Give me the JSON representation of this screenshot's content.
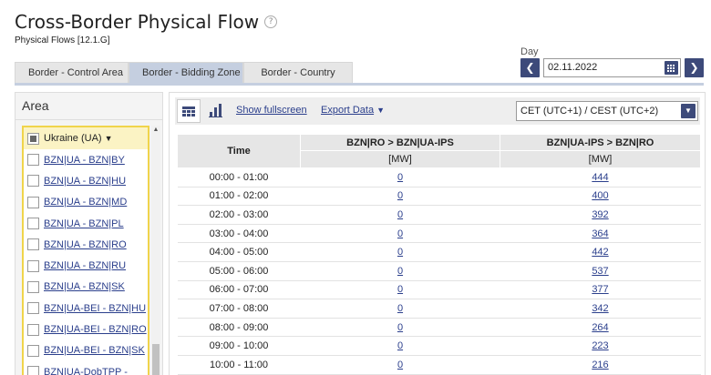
{
  "header": {
    "title": "Cross-Border Physical Flow",
    "help_icon": "?",
    "subtitle": "Physical Flows [12.1.G]"
  },
  "tabs": [
    {
      "label": "Border - Control Area",
      "active": false
    },
    {
      "label": "Border - Bidding Zone",
      "active": true
    },
    {
      "label": "Border - Country",
      "active": false
    }
  ],
  "day": {
    "label": "Day",
    "value": "02.11.2022",
    "prev_icon": "❮",
    "next_icon": "❯"
  },
  "area": {
    "title": "Area",
    "group_label": "Ukraine (UA)",
    "caret": "▼",
    "scroll_up": "▲",
    "items": [
      "BZN|UA - BZN|BY",
      "BZN|UA - BZN|HU",
      "BZN|UA - BZN|MD",
      "BZN|UA - BZN|PL",
      "BZN|UA - BZN|RO",
      "BZN|UA - BZN|RU",
      "BZN|UA - BZN|SK",
      "BZN|UA-BEI - BZN|HU",
      "BZN|UA-BEI - BZN|RO",
      "BZN|UA-BEI - BZN|SK",
      "BZN|UA-DobTPP -"
    ]
  },
  "toolbar": {
    "fullscreen_label": "Show fullscreen",
    "export_label": "Export Data",
    "export_caret": "▼",
    "timezone": "CET (UTC+1) / CEST (UTC+2)",
    "timezone_caret": "▼"
  },
  "table": {
    "time_header": "Time",
    "col1_header": "BZN|RO > BZN|UA-IPS",
    "col2_header": "BZN|UA-IPS > BZN|RO",
    "unit1": "[MW]",
    "unit2": "[MW]",
    "rows": [
      {
        "time": "00:00 - 01:00",
        "a": "0",
        "b": "444"
      },
      {
        "time": "01:00 - 02:00",
        "a": "0",
        "b": "400"
      },
      {
        "time": "02:00 - 03:00",
        "a": "0",
        "b": "392"
      },
      {
        "time": "03:00 - 04:00",
        "a": "0",
        "b": "364"
      },
      {
        "time": "04:00 - 05:00",
        "a": "0",
        "b": "442"
      },
      {
        "time": "05:00 - 06:00",
        "a": "0",
        "b": "537"
      },
      {
        "time": "06:00 - 07:00",
        "a": "0",
        "b": "377"
      },
      {
        "time": "07:00 - 08:00",
        "a": "0",
        "b": "342"
      },
      {
        "time": "08:00 - 09:00",
        "a": "0",
        "b": "264"
      },
      {
        "time": "09:00 - 10:00",
        "a": "0",
        "b": "223"
      },
      {
        "time": "10:00 - 11:00",
        "a": "0",
        "b": "216"
      }
    ]
  },
  "colors": {
    "accent": "#3d4a7a",
    "tab_active": "#c5cfe0",
    "link": "#2b3f8c",
    "area_border": "#f0d44b"
  }
}
